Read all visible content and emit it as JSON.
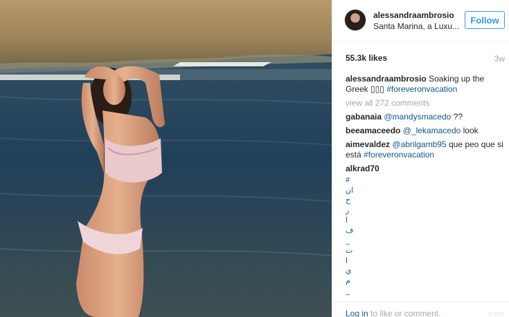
{
  "post": {
    "username": "alessandraambrosio",
    "location": "Santa Marina, a Luxu...",
    "follow_label": "Follow",
    "likes": "55.3k likes",
    "time": "3w"
  },
  "caption": {
    "user": "alessandraambrosio",
    "text": "Soaking up the Greek",
    "emoji": "▯▯▯",
    "hashtag": "#foreveronvacation"
  },
  "view_all": "view all 272 comments",
  "comments": [
    {
      "user": "gabanaia",
      "mention": "@mandysmacedo",
      "text": "??"
    },
    {
      "user": "beeamaceedo",
      "mention": "@_lekamacedo",
      "text": "look"
    },
    {
      "user": "aimevaldez",
      "mention": "@abrilgamb95",
      "text": "que peo que si está",
      "hashtag": "#foreveronvacation"
    },
    {
      "user": "alkrad70",
      "chars": [
        "#",
        "ان",
        "ح",
        "ر",
        "ا",
        "ف",
        "_",
        "ت",
        "ا",
        "ي",
        "م",
        "_"
      ]
    }
  ],
  "footer": {
    "login_link": "Log in",
    "login_text": "to like or comment.",
    "more_icon": "more-horizontal-icon"
  },
  "colors": {
    "link": "#125688",
    "follow": "#3897f0",
    "muted": "#a5a7aa"
  }
}
